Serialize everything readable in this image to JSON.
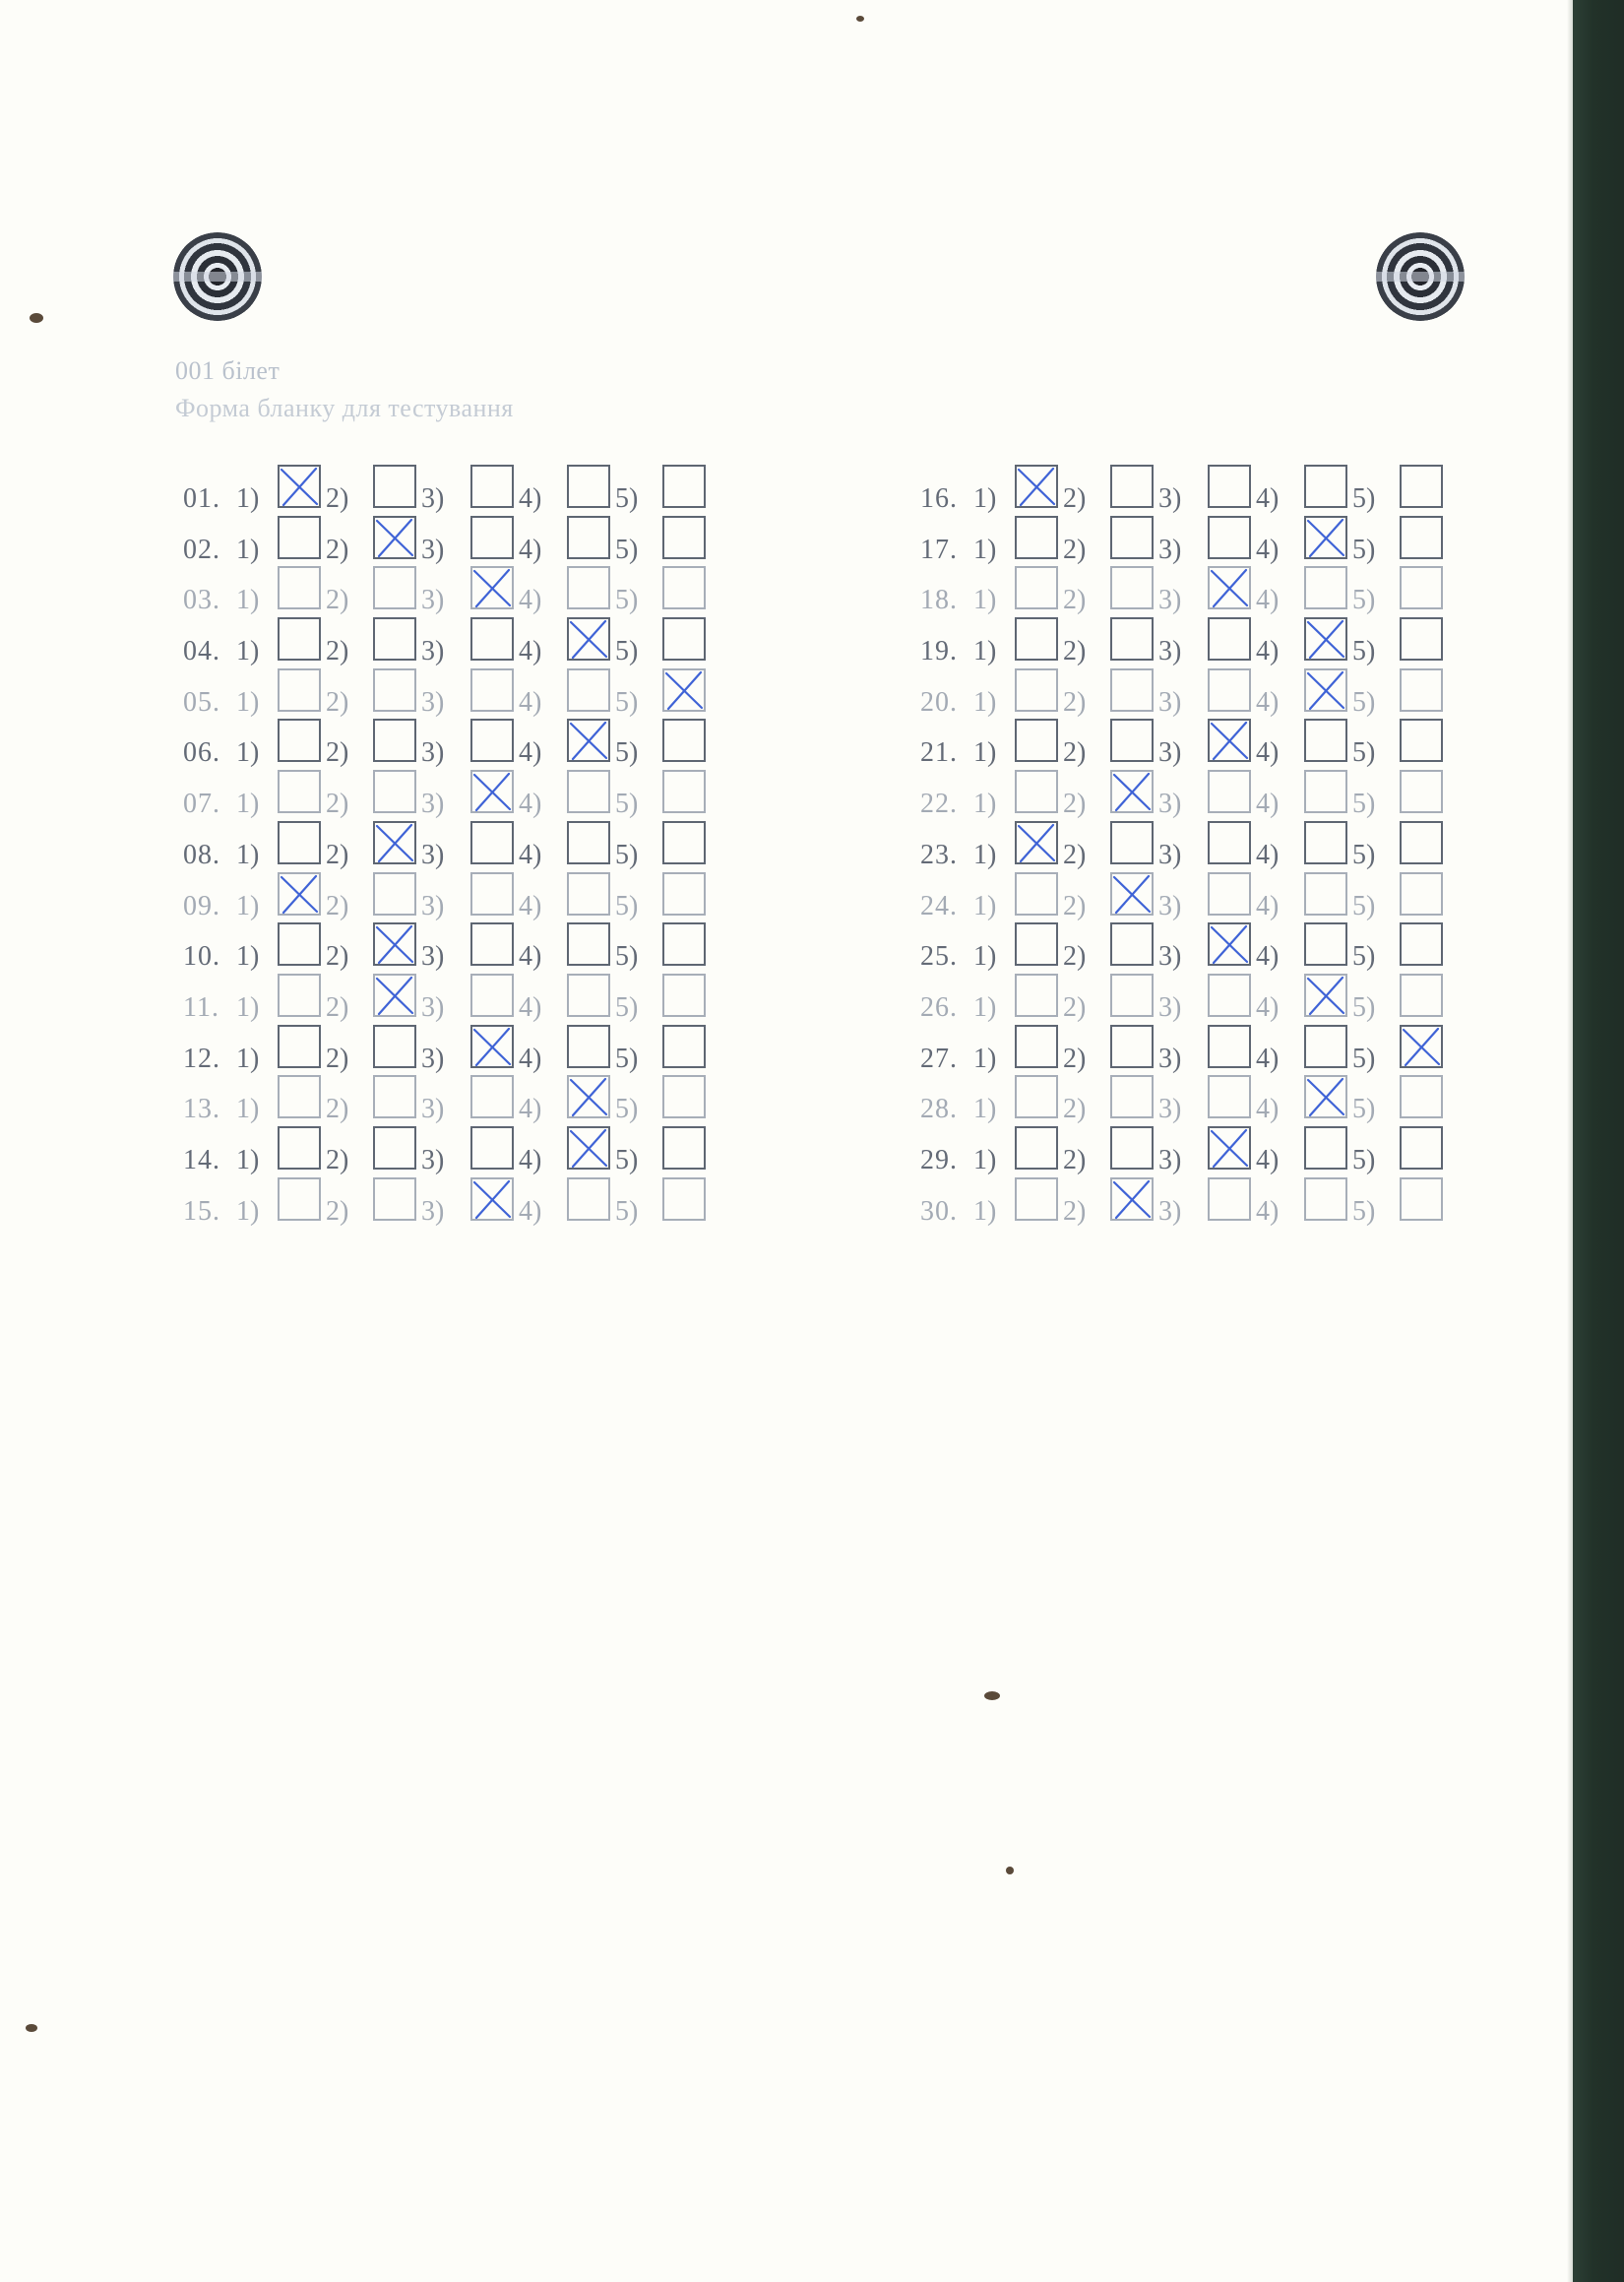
{
  "header": {
    "ticket": "001 білет",
    "form_title": "Форма бланку для тестування"
  },
  "answer_sheet": {
    "option_labels": [
      "1)",
      "2)",
      "3)",
      "4)",
      "5)"
    ],
    "left_questions": [
      {
        "num": "01.",
        "marked": 1
      },
      {
        "num": "02.",
        "marked": 2
      },
      {
        "num": "03.",
        "marked": 3
      },
      {
        "num": "04.",
        "marked": 4
      },
      {
        "num": "05.",
        "marked": 5
      },
      {
        "num": "06.",
        "marked": 4
      },
      {
        "num": "07.",
        "marked": 3
      },
      {
        "num": "08.",
        "marked": 2
      },
      {
        "num": "09.",
        "marked": 1
      },
      {
        "num": "10.",
        "marked": 2
      },
      {
        "num": "11.",
        "marked": 2
      },
      {
        "num": "12.",
        "marked": 3
      },
      {
        "num": "13.",
        "marked": 4
      },
      {
        "num": "14.",
        "marked": 4
      },
      {
        "num": "15.",
        "marked": 3
      }
    ],
    "right_questions": [
      {
        "num": "16.",
        "marked": 1
      },
      {
        "num": "17.",
        "marked": 4
      },
      {
        "num": "18.",
        "marked": 3
      },
      {
        "num": "19.",
        "marked": 4
      },
      {
        "num": "20.",
        "marked": 4
      },
      {
        "num": "21.",
        "marked": 3
      },
      {
        "num": "22.",
        "marked": 2
      },
      {
        "num": "23.",
        "marked": 1
      },
      {
        "num": "24.",
        "marked": 2
      },
      {
        "num": "25.",
        "marked": 3
      },
      {
        "num": "26.",
        "marked": 4
      },
      {
        "num": "27.",
        "marked": 5
      },
      {
        "num": "28.",
        "marked": 4
      },
      {
        "num": "29.",
        "marked": 3
      },
      {
        "num": "30.",
        "marked": 2
      }
    ],
    "mark_color": "#3f63d6"
  }
}
